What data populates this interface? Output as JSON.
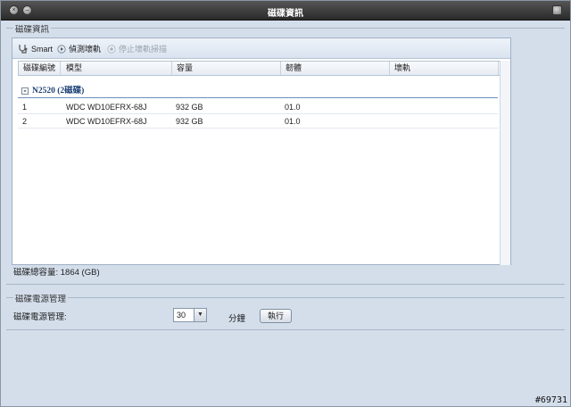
{
  "window": {
    "title": "磁碟資訊"
  },
  "disk_info": {
    "legend": "磁碟資訊",
    "toolbar": {
      "smart_label": "Smart",
      "detect_bad_label": "偵測壞軌",
      "stop_scan_label": "停止壞軌掃描"
    },
    "columns": [
      "磁碟編號",
      "模型",
      "容量",
      "韌體",
      "壞軌"
    ],
    "group": {
      "label": "N2520 (2磁碟)"
    },
    "rows": [
      {
        "id": "1",
        "model": "WDC WD10EFRX-68J",
        "capacity": "932 GB",
        "firmware": "01.0",
        "bad": ""
      },
      {
        "id": "2",
        "model": "WDC WD10EFRX-68J",
        "capacity": "932 GB",
        "firmware": "01.0",
        "bad": ""
      }
    ],
    "total": "磁碟總容量: 1864 (GB)"
  },
  "power": {
    "legend": "磁碟電源管理",
    "label": "磁碟電源管理:",
    "value": "30",
    "unit": "分鐘",
    "apply_label": "執行"
  },
  "watermark": "#69731"
}
